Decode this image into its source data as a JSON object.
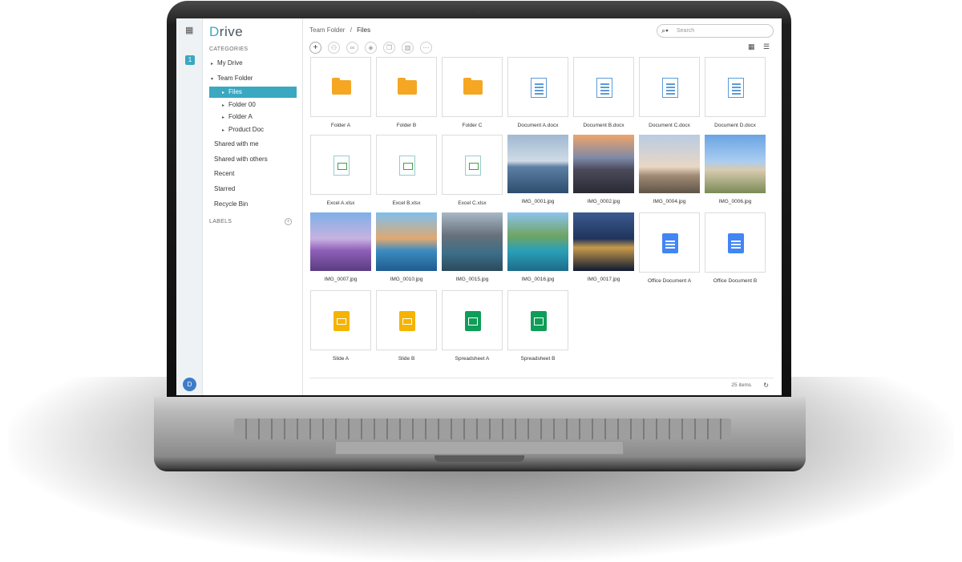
{
  "app": {
    "logo_initial": "D",
    "logo_rest": "rive"
  },
  "rail": {
    "badge": "1",
    "avatar": "D"
  },
  "sidebar": {
    "categories": "CATEGORIES",
    "my_drive": "My Drive",
    "team_folder": "Team Folder",
    "files": "Files",
    "folder00": "Folder 00",
    "folderA": "Folder A",
    "product_doc": "Product Doc",
    "shared_with_me": "Shared with me",
    "shared_with_others": "Shared with others",
    "recent": "Recent",
    "starred": "Starred",
    "recycle": "Recycle Bin",
    "labels": "LABELS"
  },
  "breadcrumb": {
    "parent": "Team Folder",
    "sep": "/",
    "current": "Files"
  },
  "search": {
    "placeholder": "Search"
  },
  "files": [
    {
      "name": "Folder A",
      "kind": "folder"
    },
    {
      "name": "Folder B",
      "kind": "folder"
    },
    {
      "name": "Folder C",
      "kind": "folder"
    },
    {
      "name": "Document A.docx",
      "kind": "docx"
    },
    {
      "name": "Document B.docx",
      "kind": "docx"
    },
    {
      "name": "Document C.docx",
      "kind": "docx"
    },
    {
      "name": "Document D.docx",
      "kind": "docx"
    },
    {
      "name": "Excel A.xlsx",
      "kind": "xlsx"
    },
    {
      "name": "Excel B.xlsx",
      "kind": "xlsx"
    },
    {
      "name": "Excel C.xlsx",
      "kind": "xlsx"
    },
    {
      "name": "IMG_0001.jpg",
      "kind": "image"
    },
    {
      "name": "IMG_0002.jpg",
      "kind": "image"
    },
    {
      "name": "IMG_0004.jpg",
      "kind": "image"
    },
    {
      "name": "IMG_0006.jpg",
      "kind": "image"
    },
    {
      "name": "IMG_0007.jpg",
      "kind": "image"
    },
    {
      "name": "IMG_0010.jpg",
      "kind": "image"
    },
    {
      "name": "IMG_0015.jpg",
      "kind": "image"
    },
    {
      "name": "IMG_0016.jpg",
      "kind": "image"
    },
    {
      "name": "IMG_0017.jpg",
      "kind": "image"
    },
    {
      "name": "Office Document A",
      "kind": "gdoc"
    },
    {
      "name": "Office Document B",
      "kind": "gdoc"
    },
    {
      "name": "Slide A",
      "kind": "gslide"
    },
    {
      "name": "Slide B",
      "kind": "gslide"
    },
    {
      "name": "Spreadsheet A",
      "kind": "gsheet"
    },
    {
      "name": "Spreadsheet B",
      "kind": "gsheet"
    }
  ],
  "footer": {
    "count": "25 items"
  },
  "colors": {
    "accent": "#3aa8c1",
    "folder": "#f5a623"
  }
}
